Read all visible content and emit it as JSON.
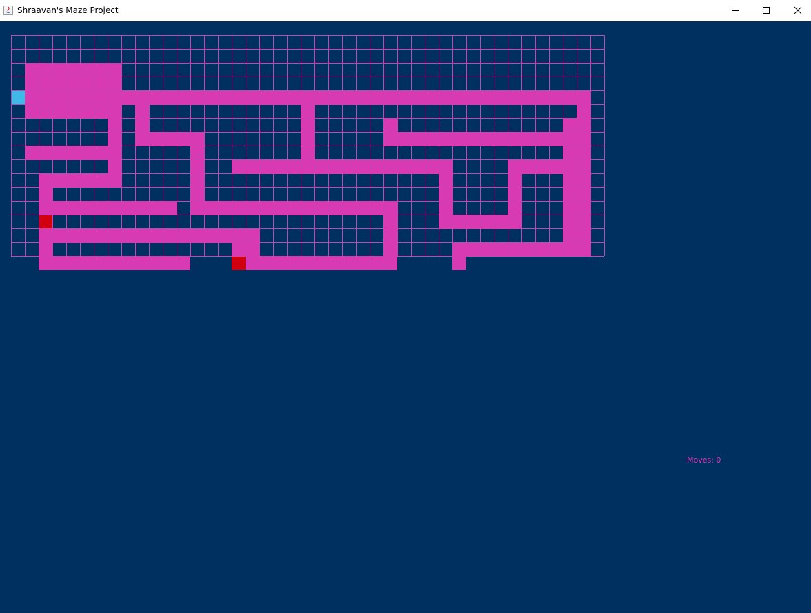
{
  "window": {
    "title": "Shraavan's Maze Project",
    "icon": "java-app-icon",
    "controls": [
      "minimize-icon",
      "maximize-icon",
      "close-icon"
    ]
  },
  "colors": {
    "background": "#003060",
    "grid_line": "#d040b0",
    "path": "#d83ab4",
    "player": "#40b8e8",
    "enemy": "#d00010",
    "moves_text": "#d83ab4"
  },
  "maze": {
    "columns": 43,
    "rows": 16,
    "path_cells": [
      [
        3,
        1
      ],
      [
        3,
        2
      ],
      [
        3,
        3
      ],
      [
        3,
        4
      ],
      [
        3,
        5
      ],
      [
        3,
        6
      ],
      [
        3,
        7
      ],
      [
        4,
        1
      ],
      [
        4,
        2
      ],
      [
        4,
        3
      ],
      [
        4,
        4
      ],
      [
        4,
        5
      ],
      [
        4,
        6
      ],
      [
        4,
        7
      ],
      [
        5,
        1
      ],
      [
        5,
        2
      ],
      [
        5,
        3
      ],
      [
        5,
        4
      ],
      [
        5,
        5
      ],
      [
        5,
        6
      ],
      [
        5,
        7
      ],
      [
        5,
        8
      ],
      [
        5,
        9
      ],
      [
        5,
        10
      ],
      [
        5,
        11
      ],
      [
        5,
        12
      ],
      [
        5,
        13
      ],
      [
        5,
        14
      ],
      [
        5,
        15
      ],
      [
        5,
        16
      ],
      [
        5,
        17
      ],
      [
        5,
        18
      ],
      [
        5,
        19
      ],
      [
        5,
        20
      ],
      [
        5,
        21
      ],
      [
        5,
        22
      ],
      [
        5,
        23
      ],
      [
        5,
        24
      ],
      [
        5,
        25
      ],
      [
        5,
        26
      ],
      [
        5,
        27
      ],
      [
        5,
        28
      ],
      [
        5,
        29
      ],
      [
        5,
        30
      ],
      [
        5,
        31
      ],
      [
        5,
        32
      ],
      [
        5,
        33
      ],
      [
        5,
        34
      ],
      [
        5,
        35
      ],
      [
        5,
        36
      ],
      [
        5,
        37
      ],
      [
        5,
        38
      ],
      [
        5,
        39
      ],
      [
        5,
        40
      ],
      [
        5,
        41
      ],
      [
        6,
        1
      ],
      [
        6,
        2
      ],
      [
        6,
        3
      ],
      [
        6,
        4
      ],
      [
        6,
        5
      ],
      [
        6,
        6
      ],
      [
        6,
        7
      ],
      [
        6,
        9
      ],
      [
        6,
        21
      ],
      [
        6,
        41
      ],
      [
        7,
        7
      ],
      [
        7,
        9
      ],
      [
        7,
        21
      ],
      [
        7,
        27
      ],
      [
        7,
        40
      ],
      [
        7,
        41
      ],
      [
        8,
        7
      ],
      [
        8,
        9
      ],
      [
        8,
        10
      ],
      [
        8,
        11
      ],
      [
        8,
        12
      ],
      [
        8,
        13
      ],
      [
        8,
        21
      ],
      [
        8,
        27
      ],
      [
        8,
        28
      ],
      [
        8,
        29
      ],
      [
        8,
        30
      ],
      [
        8,
        31
      ],
      [
        8,
        32
      ],
      [
        8,
        33
      ],
      [
        8,
        34
      ],
      [
        8,
        35
      ],
      [
        8,
        36
      ],
      [
        8,
        37
      ],
      [
        8,
        38
      ],
      [
        8,
        39
      ],
      [
        8,
        40
      ],
      [
        8,
        41
      ],
      [
        9,
        1
      ],
      [
        9,
        2
      ],
      [
        9,
        3
      ],
      [
        9,
        4
      ],
      [
        9,
        5
      ],
      [
        9,
        6
      ],
      [
        9,
        7
      ],
      [
        9,
        13
      ],
      [
        9,
        21
      ],
      [
        9,
        40
      ],
      [
        9,
        41
      ],
      [
        10,
        7
      ],
      [
        10,
        13
      ],
      [
        10,
        16
      ],
      [
        10,
        17
      ],
      [
        10,
        18
      ],
      [
        10,
        19
      ],
      [
        10,
        20
      ],
      [
        10,
        21
      ],
      [
        10,
        22
      ],
      [
        10,
        23
      ],
      [
        10,
        24
      ],
      [
        10,
        25
      ],
      [
        10,
        26
      ],
      [
        10,
        27
      ],
      [
        10,
        28
      ],
      [
        10,
        29
      ],
      [
        10,
        30
      ],
      [
        10,
        31
      ],
      [
        10,
        36
      ],
      [
        10,
        37
      ],
      [
        10,
        38
      ],
      [
        10,
        39
      ],
      [
        10,
        40
      ],
      [
        10,
        41
      ],
      [
        11,
        2
      ],
      [
        11,
        3
      ],
      [
        11,
        4
      ],
      [
        11,
        5
      ],
      [
        11,
        6
      ],
      [
        11,
        7
      ],
      [
        11,
        13
      ],
      [
        11,
        31
      ],
      [
        11,
        36
      ],
      [
        11,
        40
      ],
      [
        11,
        41
      ],
      [
        12,
        2
      ],
      [
        12,
        13
      ],
      [
        12,
        31
      ],
      [
        12,
        36
      ],
      [
        12,
        40
      ],
      [
        12,
        41
      ],
      [
        13,
        2
      ],
      [
        13,
        3
      ],
      [
        13,
        4
      ],
      [
        13,
        5
      ],
      [
        13,
        6
      ],
      [
        13,
        7
      ],
      [
        13,
        8
      ],
      [
        13,
        9
      ],
      [
        13,
        10
      ],
      [
        13,
        11
      ],
      [
        13,
        13
      ],
      [
        13,
        14
      ],
      [
        13,
        15
      ],
      [
        13,
        16
      ],
      [
        13,
        17
      ],
      [
        13,
        18
      ],
      [
        13,
        19
      ],
      [
        13,
        20
      ],
      [
        13,
        21
      ],
      [
        13,
        22
      ],
      [
        13,
        23
      ],
      [
        13,
        24
      ],
      [
        13,
        25
      ],
      [
        13,
        26
      ],
      [
        13,
        27
      ],
      [
        13,
        31
      ],
      [
        13,
        36
      ],
      [
        13,
        40
      ],
      [
        13,
        41
      ],
      [
        14,
        2
      ],
      [
        14,
        27
      ],
      [
        14,
        31
      ],
      [
        14,
        32
      ],
      [
        14,
        33
      ],
      [
        14,
        34
      ],
      [
        14,
        35
      ],
      [
        14,
        36
      ],
      [
        14,
        40
      ],
      [
        14,
        41
      ],
      [
        15,
        2
      ],
      [
        15,
        3
      ],
      [
        15,
        4
      ],
      [
        15,
        5
      ],
      [
        15,
        6
      ],
      [
        15,
        7
      ],
      [
        15,
        8
      ],
      [
        15,
        9
      ],
      [
        15,
        10
      ],
      [
        15,
        11
      ],
      [
        15,
        12
      ],
      [
        15,
        13
      ],
      [
        15,
        14
      ],
      [
        15,
        15
      ],
      [
        15,
        16
      ],
      [
        15,
        17
      ],
      [
        15,
        27
      ],
      [
        15,
        40
      ],
      [
        15,
        41
      ],
      [
        16,
        2
      ],
      [
        16,
        16
      ],
      [
        16,
        17
      ],
      [
        16,
        27
      ],
      [
        16,
        32
      ],
      [
        16,
        33
      ],
      [
        16,
        34
      ],
      [
        16,
        35
      ],
      [
        16,
        36
      ],
      [
        16,
        37
      ],
      [
        16,
        38
      ],
      [
        16,
        39
      ],
      [
        16,
        40
      ],
      [
        16,
        41
      ],
      [
        17,
        2
      ],
      [
        17,
        3
      ],
      [
        17,
        4
      ],
      [
        17,
        5
      ],
      [
        17,
        6
      ],
      [
        17,
        7
      ],
      [
        17,
        8
      ],
      [
        17,
        9
      ],
      [
        17,
        10
      ],
      [
        17,
        11
      ],
      [
        17,
        12
      ],
      [
        17,
        17
      ],
      [
        17,
        18
      ],
      [
        17,
        19
      ],
      [
        17,
        20
      ],
      [
        17,
        21
      ],
      [
        17,
        22
      ],
      [
        17,
        23
      ],
      [
        17,
        24
      ],
      [
        17,
        25
      ],
      [
        17,
        26
      ],
      [
        17,
        27
      ],
      [
        17,
        32
      ],
      [
        18,
        32
      ]
    ],
    "player": [
      5,
      0
    ],
    "enemies": [
      [
        14,
        2
      ],
      [
        17,
        16
      ]
    ]
  },
  "status": {
    "moves_label": "Moves: 0"
  }
}
